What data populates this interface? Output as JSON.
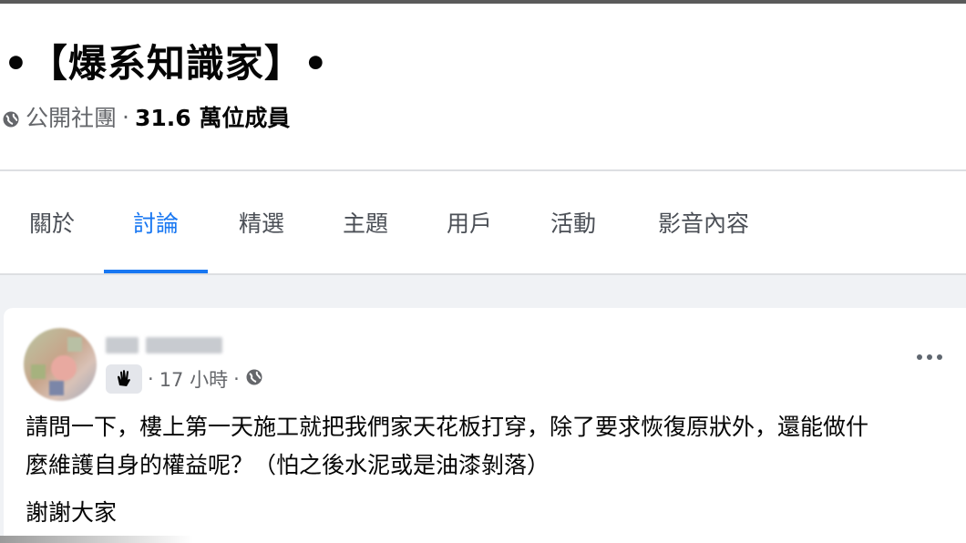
{
  "group": {
    "title": "•【爆系知識家】•",
    "privacy": "公開社團",
    "separator": "·",
    "members": "31.6 萬位成員"
  },
  "tabs": [
    {
      "label": "關於",
      "active": false
    },
    {
      "label": "討論",
      "active": true
    },
    {
      "label": "精選",
      "active": false
    },
    {
      "label": "主題",
      "active": false
    },
    {
      "label": "用戶",
      "active": false
    },
    {
      "label": "活動",
      "active": false
    },
    {
      "label": "影音內容",
      "active": false
    }
  ],
  "post": {
    "time": "17 小時",
    "dot": "·",
    "body_line1": "請問一下，樓上第一天施工就把我們家天花板打穿，除了要求恢復原狀外，還能做什",
    "body_line2": "麼維護自身的權益呢？（怕之後水泥或是油漆剝落）",
    "body_line3": "謝謝大家"
  },
  "colors": {
    "accent": "#1877f2",
    "feed_background": "#f0f2f5",
    "secondary_text": "#65676b"
  },
  "icons": {
    "privacy": "globe-icon",
    "badge": "new-member-wave-icon",
    "audience": "public-globe-icon",
    "more": "more-options-icon"
  }
}
